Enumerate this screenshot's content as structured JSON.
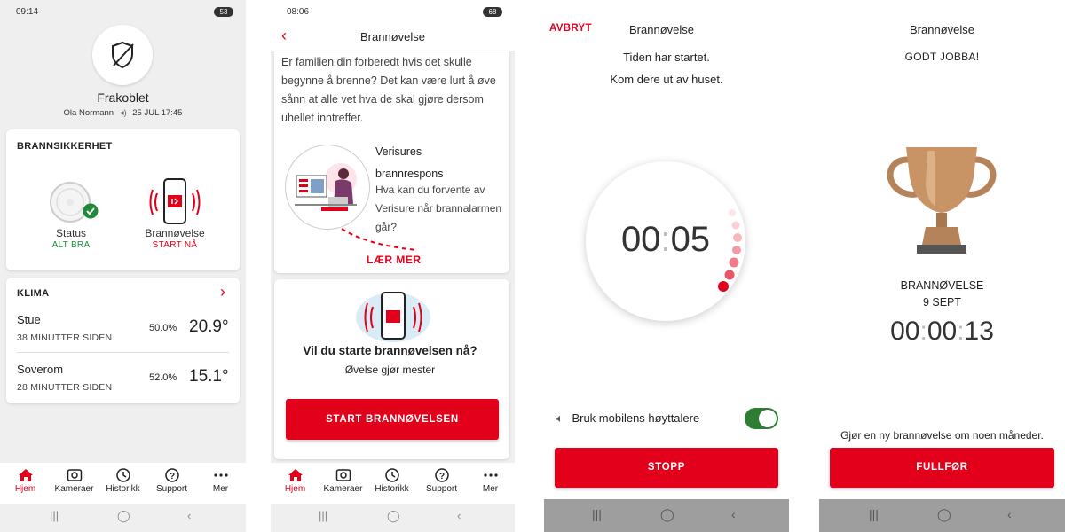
{
  "screen1": {
    "status_time": "09:14",
    "battery": "53",
    "status_title": "Frakoblet",
    "user": "Ola Normann",
    "date": "25 JUL 17:45",
    "fire_card_title": "BRANNSIKKERHET",
    "status_label": "Status",
    "status_value": "ALT BRA",
    "drill_label": "Brannøvelse",
    "drill_action": "START NÅ",
    "climate_title": "KLIMA",
    "rooms": [
      {
        "name": "Stue",
        "time": "38 MINUTTER SIDEN",
        "humidity": "50.0%",
        "temp": "20.9°"
      },
      {
        "name": "Soverom",
        "time": "28 MINUTTER SIDEN",
        "humidity": "52.0%",
        "temp": "15.1°"
      }
    ]
  },
  "nav": {
    "items": [
      {
        "label": "Hjem",
        "icon": "home-icon"
      },
      {
        "label": "Kameraer",
        "icon": "camera-icon"
      },
      {
        "label": "Historikk",
        "icon": "clock-icon"
      },
      {
        "label": "Support",
        "icon": "question-icon"
      },
      {
        "label": "Mer",
        "icon": "more-icon"
      }
    ]
  },
  "screen2": {
    "status_time": "08:06",
    "battery": "68",
    "title": "Brannøvelse",
    "intro": "Er familien din forberedt hvis det skulle begynne å brenne? Det kan være lurt å øve sånn at alle vet hva de skal gjøre dersom uhellet inntreffer.",
    "veri_title_1": "Verisures",
    "veri_title_2": "brannrespons",
    "veri_desc": "Hva kan du forvente av Verisure når brannalarmen går?",
    "learn_more": "LÆR MER",
    "question": "Vil du starte brannøvelsen nå?",
    "question_sub": "Øvelse gjør mester",
    "start_button": "START BRANNØVELSEN"
  },
  "screen3": {
    "cancel": "AVBRYT",
    "title": "Brannøvelse",
    "msg1": "Tiden har startet.",
    "msg2": "Kom dere ut av huset.",
    "timer_min": "00",
    "timer_sec": "05",
    "speaker_label": "Bruk mobilens høyttalere",
    "speaker_on": true,
    "stop_button": "STOPP"
  },
  "screen4": {
    "title": "Brannøvelse",
    "congrats": "GODT JOBBA!",
    "drill_label": "BRANNØVELSE",
    "drill_date": "9 SEPT",
    "time_h": "00",
    "time_m": "00",
    "time_s": "13",
    "next_msg": "Gjør en ny brannøvelse om noen måneder.",
    "finish_button": "FULLFØR"
  },
  "colors": {
    "accent": "#e3001b",
    "ok_green": "#1e8a3a",
    "toggle_green": "#2e7d32"
  }
}
